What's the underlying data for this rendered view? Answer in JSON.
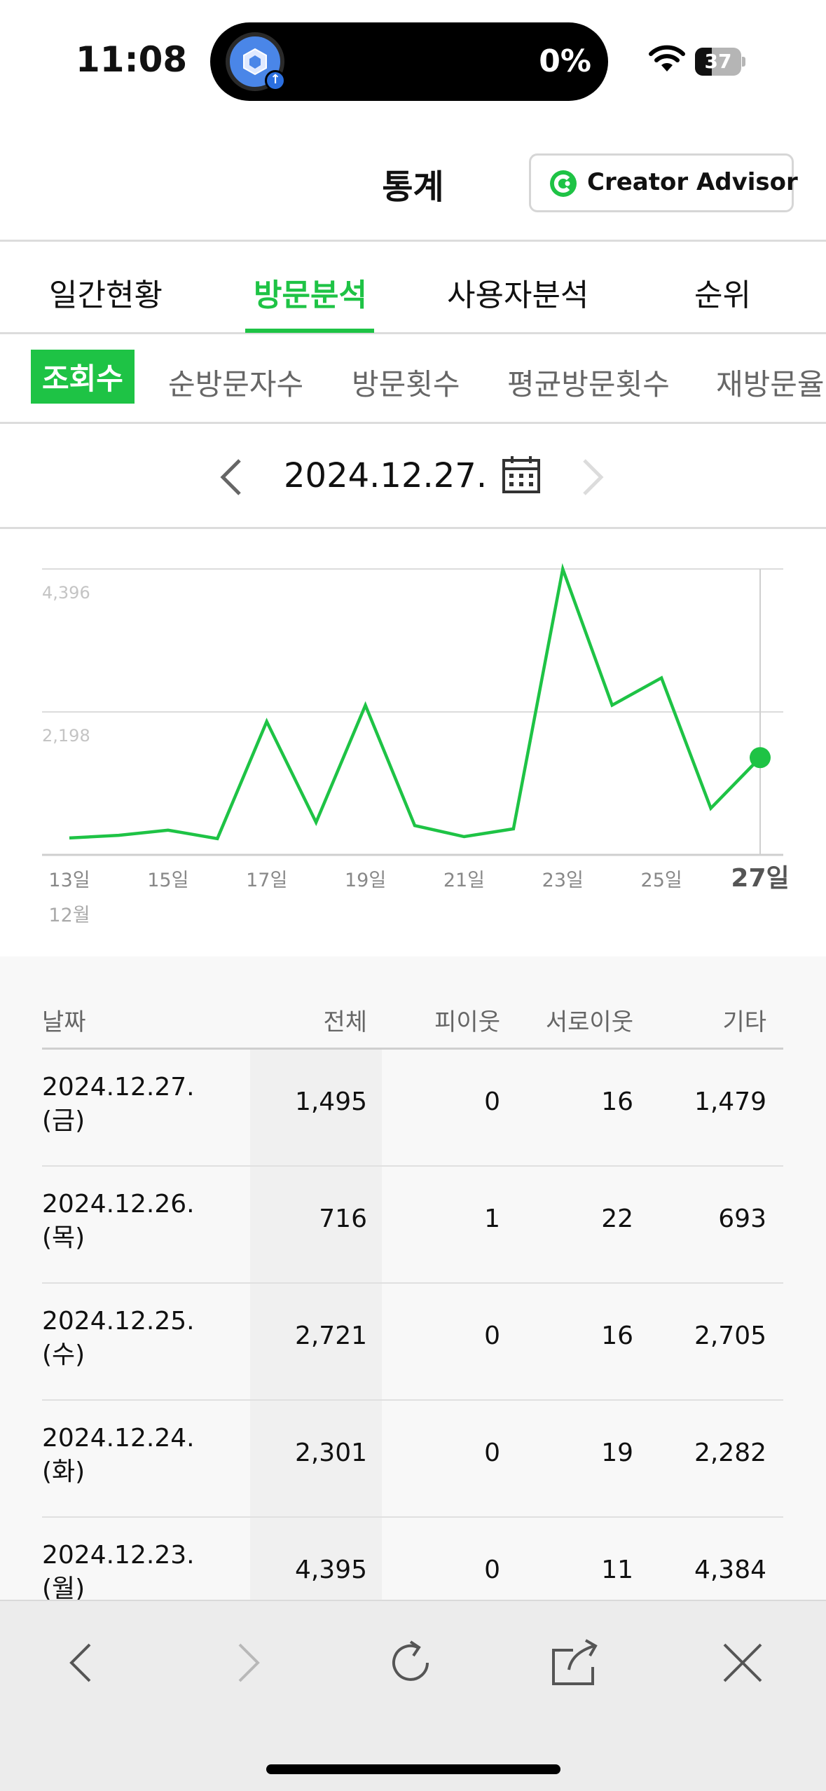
{
  "status_bar": {
    "time": "11:08",
    "island_percent": "0%",
    "battery": "37"
  },
  "header": {
    "title": "통계",
    "creator_advisor_label": "Creator Advisor"
  },
  "main_tabs": [
    {
      "label": "일간현황",
      "active": false
    },
    {
      "label": "방문분석",
      "active": true
    },
    {
      "label": "사용자분석",
      "active": false
    },
    {
      "label": "순위",
      "active": false
    }
  ],
  "sub_tabs": [
    {
      "label": "조회수",
      "active": true
    },
    {
      "label": "순방문자수",
      "active": false
    },
    {
      "label": "방문횟수",
      "active": false
    },
    {
      "label": "평균방문횟수",
      "active": false
    },
    {
      "label": "재방문율",
      "active": false
    }
  ],
  "date_nav": {
    "date": "2024.12.27."
  },
  "chart_data": {
    "type": "line",
    "x": [
      13,
      14,
      15,
      16,
      17,
      18,
      19,
      20,
      21,
      22,
      23,
      24,
      25,
      26,
      27
    ],
    "values": [
      260,
      300,
      380,
      250,
      2050,
      500,
      2300,
      450,
      280,
      400,
      4395,
      2301,
      2721,
      716,
      1495
    ],
    "x_tick_labels": [
      "13일",
      "15일",
      "17일",
      "19일",
      "21일",
      "23일",
      "25일",
      "27일"
    ],
    "x_month_label": "12월",
    "y_tick_labels": [
      "4,396",
      "2,198"
    ],
    "ylim": [
      0,
      4396
    ],
    "grid": true,
    "line_color": "#1ec345"
  },
  "table": {
    "headers": [
      "날짜",
      "전체",
      "피이웃",
      "서로이웃",
      "기타"
    ],
    "rows": [
      {
        "date": "2024.12.27.",
        "day": "(금)",
        "total": "1,495",
        "pi": "0",
        "mutual": "16",
        "etc": "1,479"
      },
      {
        "date": "2024.12.26.",
        "day": "(목)",
        "total": "716",
        "pi": "1",
        "mutual": "22",
        "etc": "693"
      },
      {
        "date": "2024.12.25.",
        "day": "(수)",
        "total": "2,721",
        "pi": "0",
        "mutual": "16",
        "etc": "2,705"
      },
      {
        "date": "2024.12.24.",
        "day": "(화)",
        "total": "2,301",
        "pi": "0",
        "mutual": "19",
        "etc": "2,282"
      },
      {
        "date": "2024.12.23.",
        "day": "(월)",
        "total": "4,395",
        "pi": "0",
        "mutual": "11",
        "etc": "4,384"
      }
    ]
  },
  "toolbar": {
    "icons": [
      "back-icon",
      "forward-icon",
      "reload-icon",
      "share-icon",
      "close-icon"
    ]
  }
}
